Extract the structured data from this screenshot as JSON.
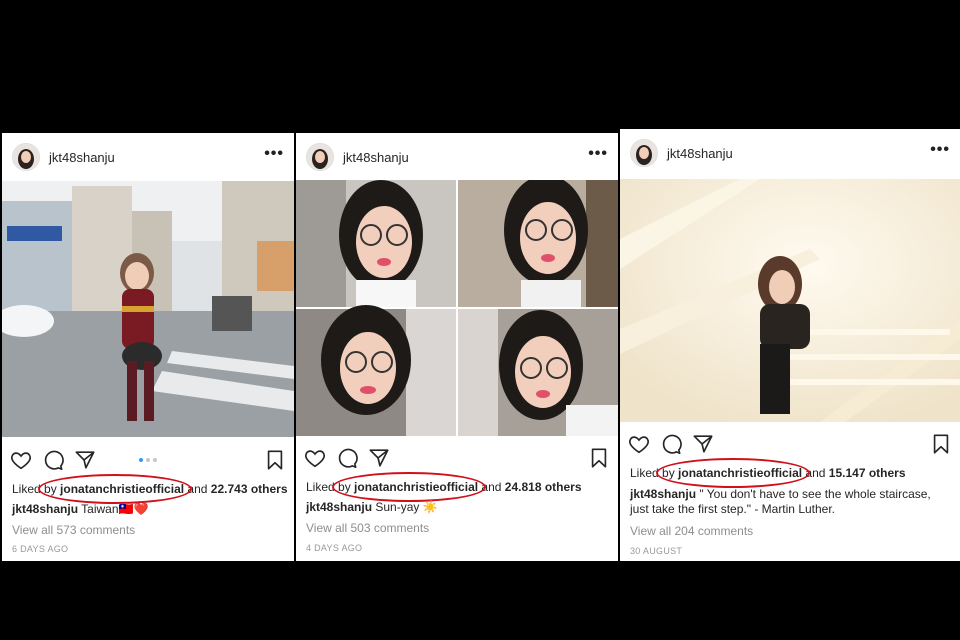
{
  "posts": [
    {
      "username": "jkt48shanju",
      "more": "•••",
      "liked_prefix": "Liked by",
      "liked_by": "jonatanchristieofficial",
      "and_text": "and",
      "others": "22.743 others",
      "caption_user": "jkt48shanju",
      "caption_text": "Taiwan🇹🇼❤️",
      "view_comments": "View all 573 comments",
      "timestamp": "6 DAYS AGO",
      "carousel_dots": 3,
      "carousel_active": 1
    },
    {
      "username": "jkt48shanju",
      "more": "•••",
      "liked_prefix": "Liked by",
      "liked_by": "jonatanchristieofficial",
      "and_text": "and",
      "others": "24.818 others",
      "caption_user": "jkt48shanju",
      "caption_text": "Sun-yay ☀️",
      "view_comments": "View all 503 comments",
      "timestamp": "4 DAYS AGO"
    },
    {
      "username": "jkt48shanju",
      "more": "•••",
      "liked_prefix": "Liked by",
      "liked_by": "jonatanchristieofficial",
      "and_text": "and",
      "others": "15.147 others",
      "caption_user": "jkt48shanju",
      "caption_text": "\" You don't have to see the whole staircase, just take the first step.\" - Martin Luther.",
      "view_comments": "View all 204 comments",
      "timestamp": "30 AUGUST"
    }
  ],
  "icons": [
    "heart-icon",
    "comment-icon",
    "share-icon",
    "bookmark-icon",
    "more-icon"
  ],
  "colors": {
    "highlight_circle": "#d0101a",
    "active_dot": "#3897f0",
    "muted_text": "#8e8e8e"
  }
}
